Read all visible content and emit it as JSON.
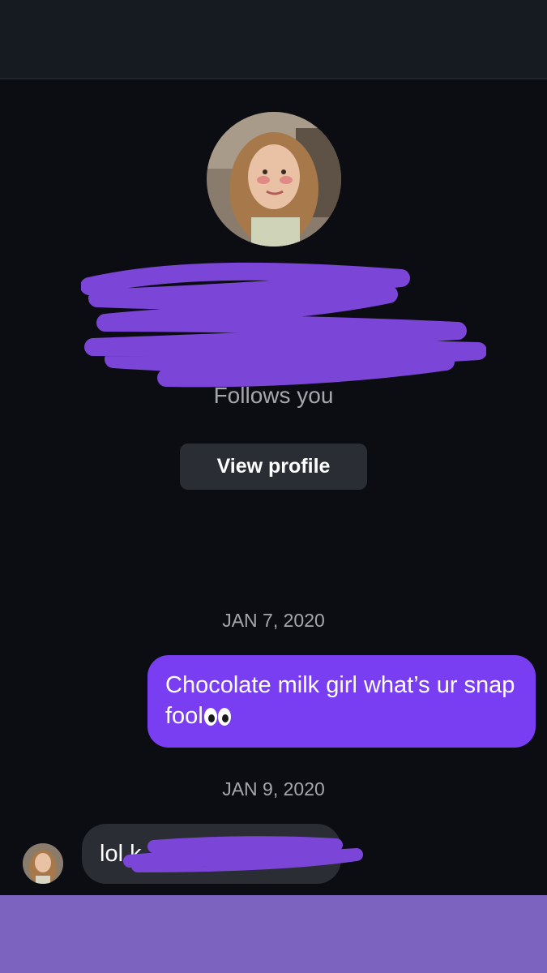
{
  "profile": {
    "follows_text": "Follows you",
    "view_profile_label": "View profile"
  },
  "conversation": {
    "dates": [
      "JAN 7, 2020",
      "JAN 9, 2020"
    ],
    "sent_message": {
      "text": "Chocolate milk girl what’s ur snap fool",
      "emoji": "eyes"
    },
    "received_message": {
      "visible_text": "lol k"
    }
  },
  "colors": {
    "background": "#0b0d12",
    "sent_bubble": "#7a3ef2",
    "received_bubble": "#2a2d33",
    "redaction": "#7b45d8",
    "bottom_bar": "#7c63bf"
  }
}
